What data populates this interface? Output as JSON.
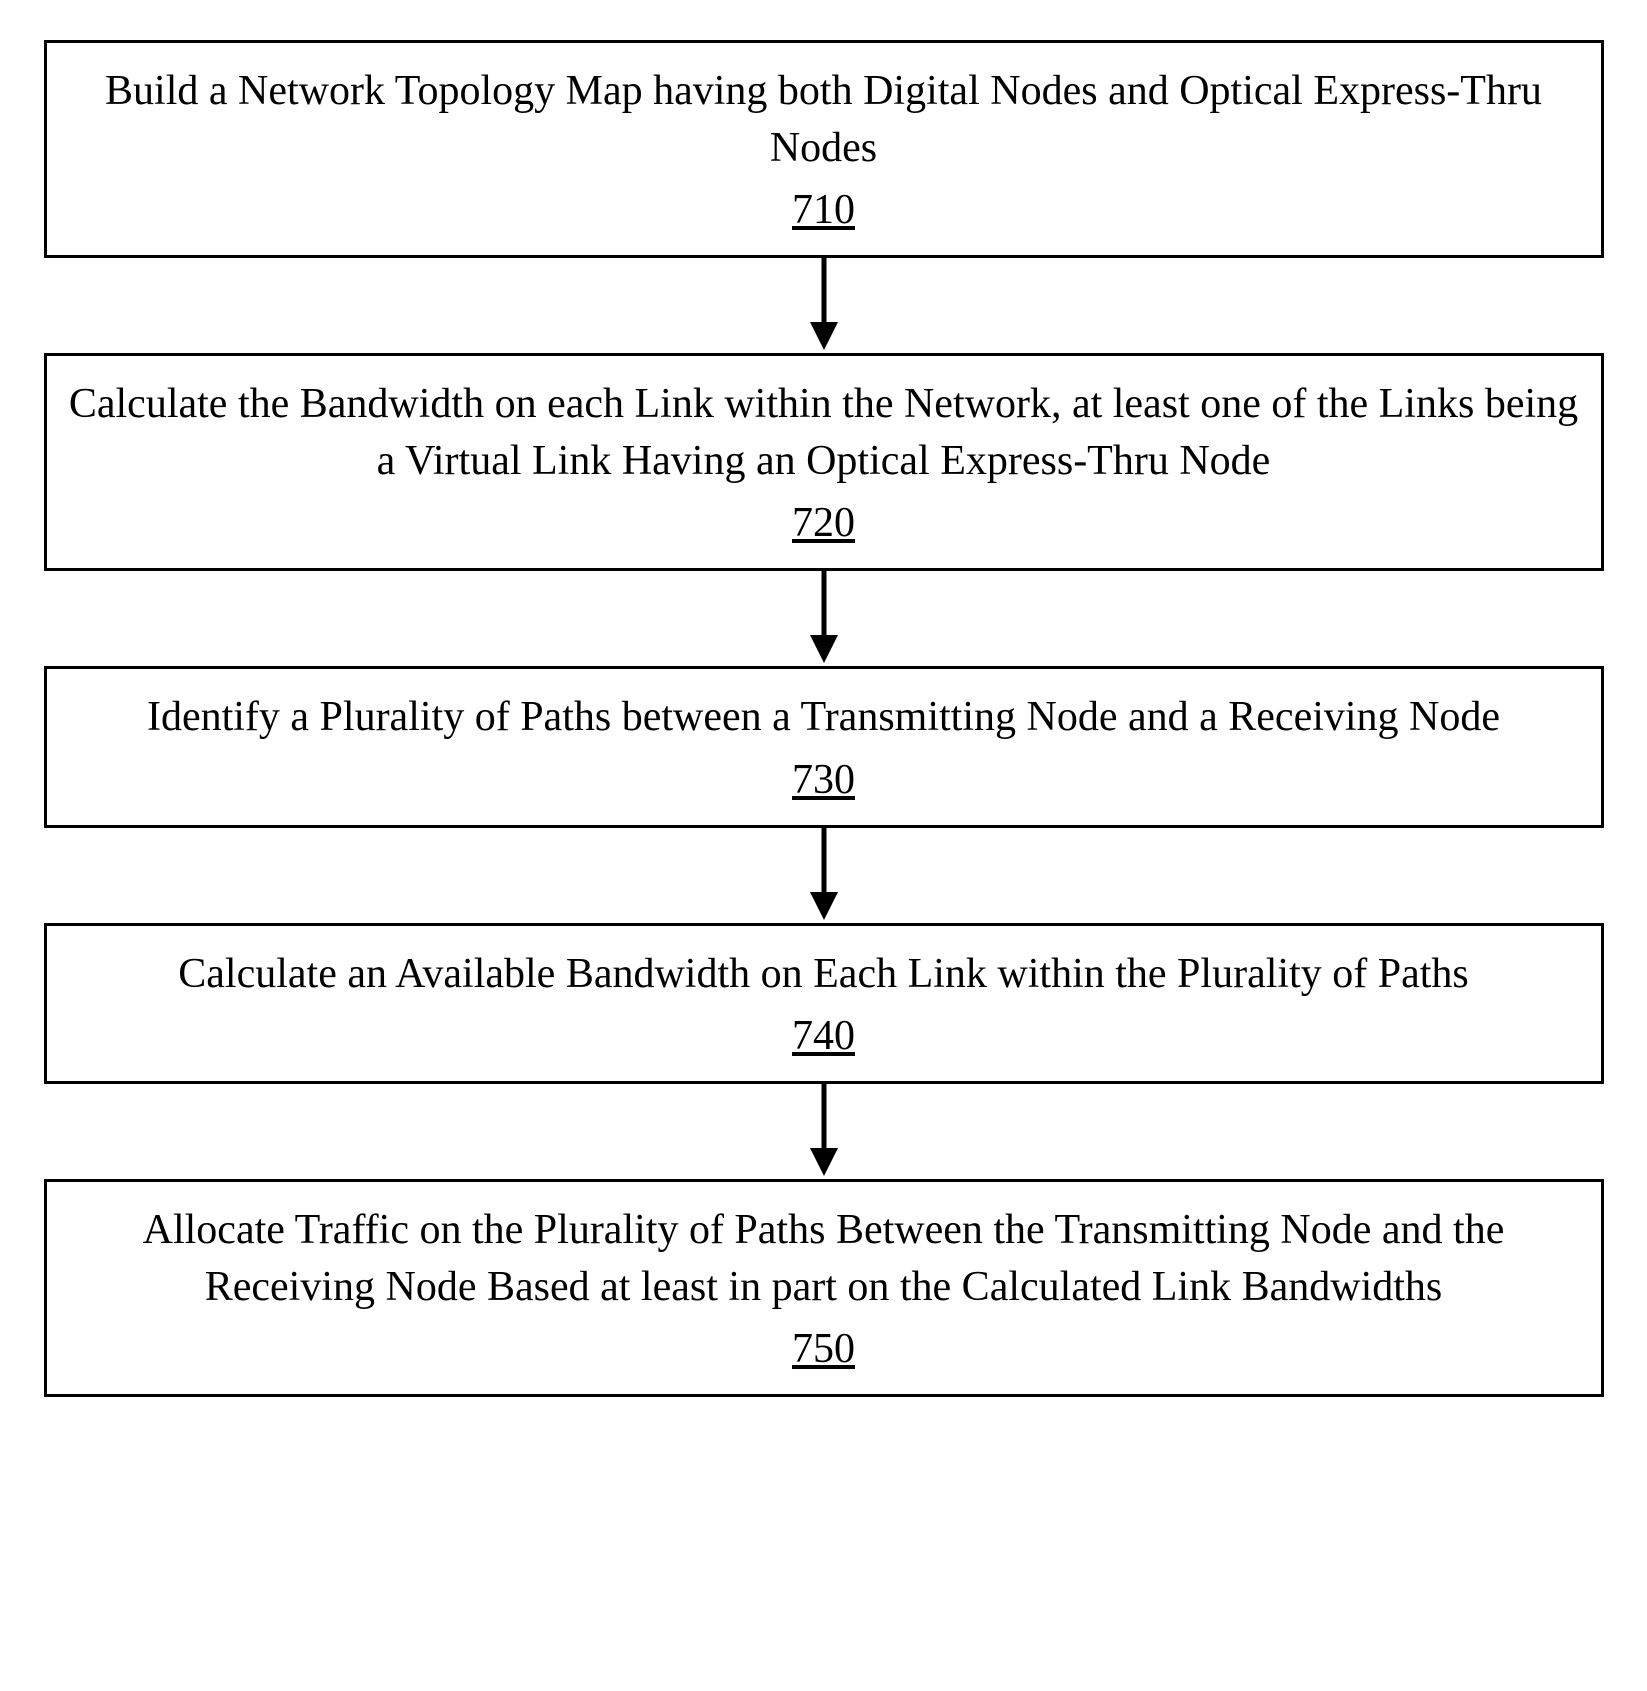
{
  "steps": [
    {
      "text": "Build a Network Topology Map having both Digital Nodes and Optical Express-Thru Nodes",
      "ref": "710"
    },
    {
      "text": "Calculate the Bandwidth on each Link within the Network, at least one of the Links being a Virtual Link Having an Optical Express-Thru Node",
      "ref": "720"
    },
    {
      "text": "Identify a Plurality of Paths between a Transmitting Node and a Receiving Node",
      "ref": "730"
    },
    {
      "text": "Calculate an Available Bandwidth on Each Link within the Plurality of Paths",
      "ref": "740"
    },
    {
      "text": "Allocate Traffic on the Plurality of Paths Between the Transmitting Node and the Receiving Node Based at least in part on the Calculated Link Bandwidths",
      "ref": "750"
    }
  ]
}
